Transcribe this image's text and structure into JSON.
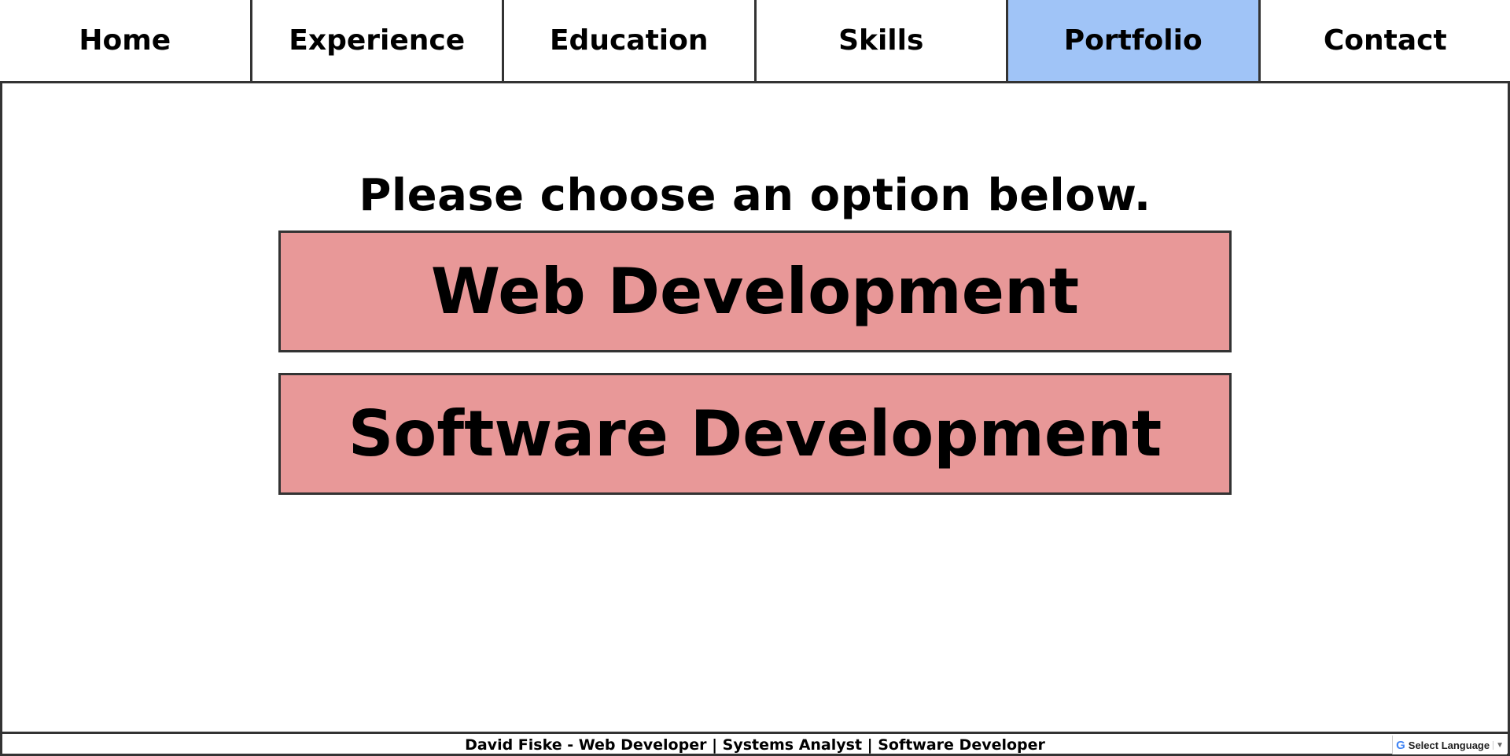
{
  "nav": {
    "items": [
      {
        "label": "Home"
      },
      {
        "label": "Experience"
      },
      {
        "label": "Education"
      },
      {
        "label": "Skills"
      },
      {
        "label": "Portfolio",
        "active": true
      },
      {
        "label": "Contact"
      }
    ]
  },
  "main": {
    "prompt": "Please choose an option below.",
    "options": [
      {
        "label": "Web Development"
      },
      {
        "label": "Software Development"
      }
    ]
  },
  "footer": {
    "text": "David Fiske - Web Developer | Systems Analyst | Software Developer"
  },
  "translate": {
    "g_letter": "G",
    "label": "Select Language",
    "arrow": "▼"
  },
  "colors": {
    "active_tab": "#a0c4f7",
    "option_bg": "#e89898",
    "border": "#333333"
  }
}
